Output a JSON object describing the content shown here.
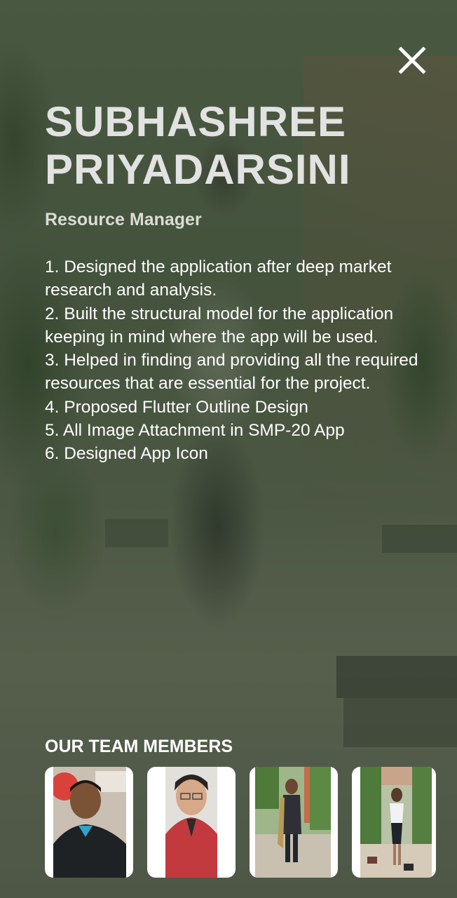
{
  "profile": {
    "name_line1": "SUBHASHREE",
    "name_line2": "PRIYADARSINI",
    "role": "Resource Manager",
    "contributions": [
      "1. Designed the application after deep market research and analysis.",
      "2. Built the structural model for the application keeping in mind where the app will be used.",
      "3. Helped in finding and providing all the required resources that are essential for the project.",
      "4. Proposed Flutter Outline Design",
      "5. All Image Attachment in SMP-20 App",
      "6. Designed App Icon"
    ]
  },
  "team": {
    "title": "OUR TEAM MEMBERS",
    "member_count_visible": 4
  },
  "icons": {
    "close": "close-icon"
  },
  "colors": {
    "overlay": "#374430",
    "card_background": "#ffffff",
    "name_text": "#e2e2e2",
    "body_text": "#ffffff"
  }
}
